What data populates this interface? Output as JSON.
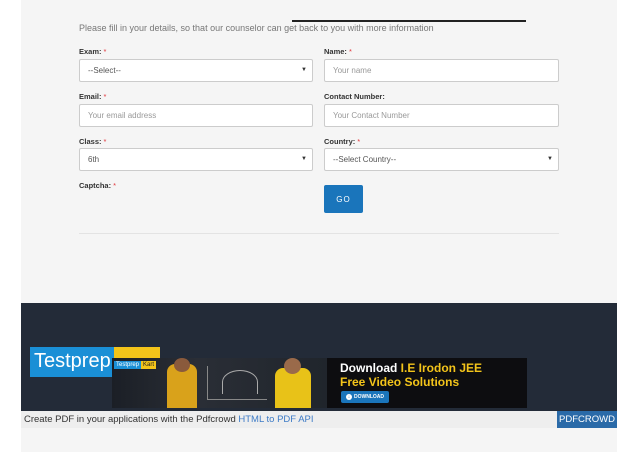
{
  "intro": "Please fill in your details, so that our counselor can get back to you with more information",
  "form": {
    "exam": {
      "label": "Exam:",
      "required": "*",
      "value": "--Select--"
    },
    "name": {
      "label": "Name:",
      "required": "*",
      "placeholder": "Your name"
    },
    "email": {
      "label": "Email:",
      "required": "*",
      "placeholder": "Your email address"
    },
    "contact": {
      "label": "Contact Number:",
      "placeholder": "Your Contact Number"
    },
    "class": {
      "label": "Class:",
      "required": "*",
      "value": "6th"
    },
    "country": {
      "label": "Country:",
      "required": "*",
      "value": "--Select Country--"
    },
    "captcha": {
      "label": "Captcha:",
      "required": "*"
    },
    "submit_label": "GO"
  },
  "footer": {
    "logo_text": "Testprep",
    "banner": {
      "mini_logo_left": "Testprep",
      "mini_logo_right": "Kart",
      "title_prefix": "Download ",
      "title_highlight": "I.E Irodon JEE",
      "subtitle": "Free Video Solutions",
      "button_label": "DOWNLOAD"
    }
  },
  "pdfcrowd": {
    "text": "Create PDF in your applications with the Pdfcrowd ",
    "link": "HTML to PDF API",
    "button": "PDFCROWD"
  },
  "icons": {
    "select_caret": "caret-down-icon",
    "download": "download-icon"
  },
  "colors": {
    "primary": "#1a75bb",
    "footer_bg": "#232b38",
    "required": "#e0363b",
    "brand_yellow": "#f3c41a",
    "brand_blue": "#1a8fd6"
  }
}
